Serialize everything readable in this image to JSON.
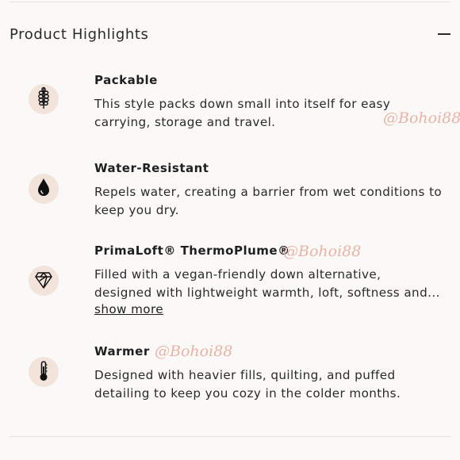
{
  "section": {
    "title": "Product Highlights"
  },
  "features": [
    {
      "icon": "lavender-sprig-icon",
      "title": "Packable",
      "description_lines": [
        "This style packs down small into itself for easy",
        "carrying, storage and travel."
      ]
    },
    {
      "icon": "water-drop-icon",
      "title": "Water-Resistant",
      "description_lines": [
        "Repels water, creating a barrier from wet conditions to",
        "keep you dry."
      ]
    },
    {
      "icon": "feather-diamond-icon",
      "title": "PrimaLoft® ThermoPlume®",
      "description_lines": [
        "Filled with a vegan-friendly down alternative,",
        "designed with lightweight warmth, loft, softness and..."
      ],
      "show_more": "show more"
    },
    {
      "icon": "thermometer-icon",
      "title": "Warmer",
      "description_lines": [
        "Designed with heavier fills, quilting, and puffed",
        "detailing to keep you cozy in the colder months."
      ]
    }
  ],
  "watermark": "@Bohoi88",
  "colors": {
    "background": "#faf9f7",
    "icon_badge": "#f2e3db",
    "watermark": "#e8b3a6",
    "divider": "#e3e0dc"
  }
}
